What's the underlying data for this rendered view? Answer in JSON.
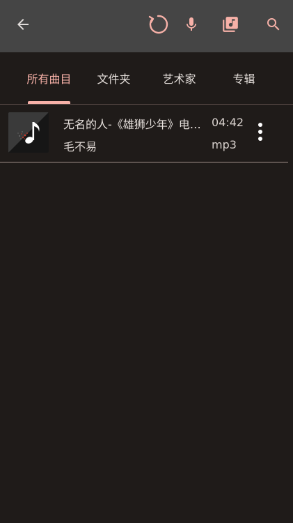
{
  "colors": {
    "toolbar_bg": "#454545",
    "page_bg": "#1f1b19",
    "accent": "#f7b1a8",
    "icon_light": "#e0dcda"
  },
  "toolbar": {
    "icons": [
      "back-arrow-icon",
      "refresh-icon",
      "microphone-icon",
      "music-library-icon",
      "search-icon"
    ]
  },
  "tabs": [
    {
      "label": "所有曲目",
      "selected": true
    },
    {
      "label": "文件夹",
      "selected": false
    },
    {
      "label": "艺术家",
      "selected": false
    },
    {
      "label": "专辑",
      "selected": false
    }
  ],
  "songs": [
    {
      "title": "无名的人-《雄狮少年》电影主题曲",
      "artist": "毛不易",
      "duration": "04:42",
      "format": "mp3",
      "cover_icon": "music-note-icon",
      "menu_icon": "more-vert-icon"
    }
  ]
}
